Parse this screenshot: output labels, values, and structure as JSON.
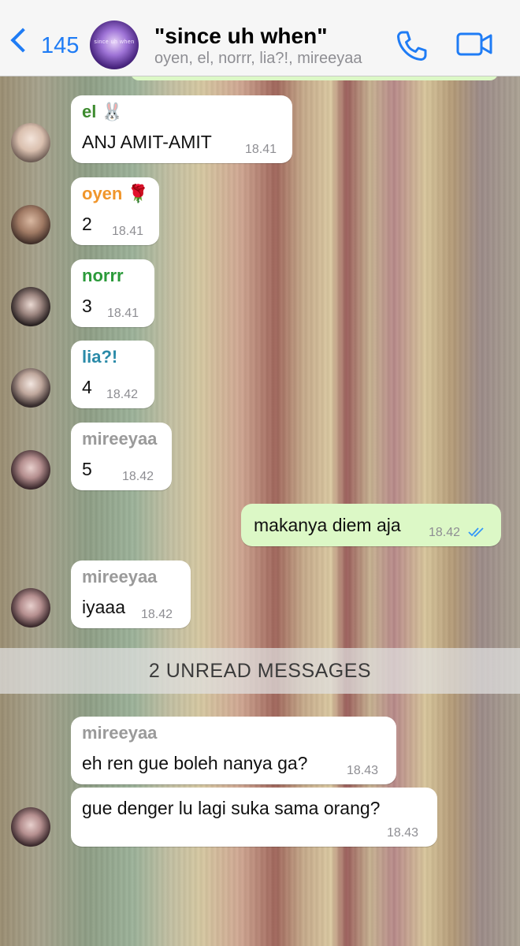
{
  "header": {
    "back_count": "145",
    "title": "\"since uh when\"",
    "subtitle": "oyen, el, norrr, lia?!, mireeyaa",
    "group_avatar_text": "since uh when"
  },
  "colors": {
    "accent": "#1f7cf5",
    "outgoing_bubble": "#dcf8c6",
    "incoming_bubble": "#ffffff",
    "name_el": "#3d8b2f",
    "name_oyen": "#f0962c",
    "name_norrr": "#2b9a3a",
    "name_lia": "#2a8aa8",
    "name_mireeyaa": "#9a9a9a"
  },
  "messages": [
    {
      "sender": "el",
      "sender_emoji": "🐰",
      "text": "ANJ AMIT-AMIT",
      "time": "18.41"
    },
    {
      "sender": "oyen",
      "sender_emoji": "🌹",
      "text": "2",
      "time": "18.41"
    },
    {
      "sender": "norrr",
      "text": "3",
      "time": "18.41"
    },
    {
      "sender": "lia?!",
      "text": "4",
      "time": "18.42"
    },
    {
      "sender": "mireeyaa",
      "text": "5",
      "time": "18.42"
    },
    {
      "sender": "me",
      "text": "makanya diem aja",
      "time": "18.42",
      "status": "read-checkmarks-icon"
    },
    {
      "sender": "mireeyaa",
      "text": "iyaaa",
      "time": "18.42"
    },
    {
      "sender": "mireeyaa",
      "text": "eh ren gue boleh nanya ga?",
      "time": "18.43"
    },
    {
      "sender": "mireeyaa",
      "text": "gue denger lu lagi suka sama orang?",
      "time": "18.43"
    }
  ],
  "unread_label": "2 UNREAD MESSAGES"
}
